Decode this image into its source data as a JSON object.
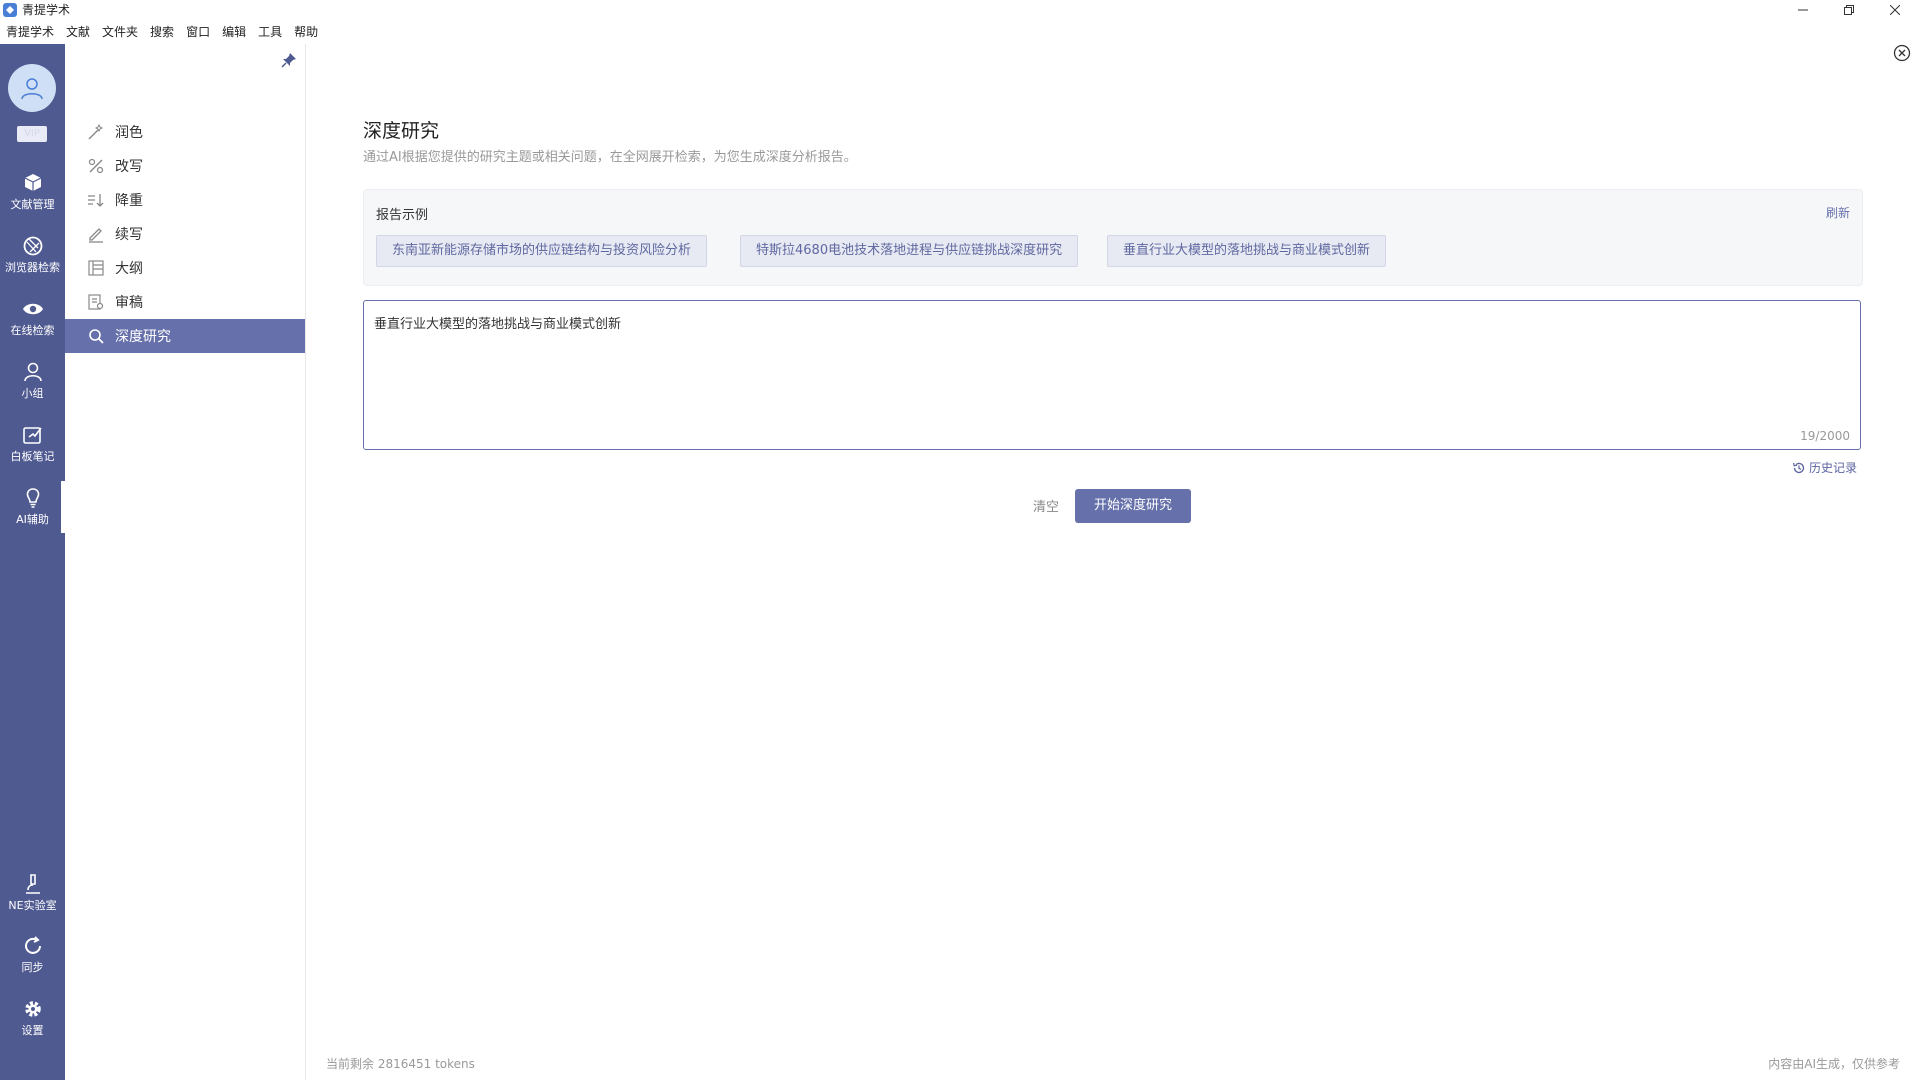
{
  "window": {
    "title": "青提学术"
  },
  "menu": [
    "青提学术",
    "文献",
    "文件夹",
    "搜索",
    "窗口",
    "编辑",
    "工具",
    "帮助"
  ],
  "rail": {
    "vip": "VIP",
    "items": [
      {
        "label": "文献管理",
        "icon": "box-icon"
      },
      {
        "label": "浏览器检索",
        "icon": "browser-icon"
      },
      {
        "label": "在线检索",
        "icon": "eye-icon"
      },
      {
        "label": "小组",
        "icon": "group-icon"
      },
      {
        "label": "白板笔记",
        "icon": "whiteboard-icon"
      },
      {
        "label": "AI辅助",
        "icon": "bulb-icon"
      },
      {
        "label": "NE实验室",
        "icon": "microscope-icon"
      },
      {
        "label": "同步",
        "icon": "sync-icon"
      },
      {
        "label": "设置",
        "icon": "gear-icon"
      }
    ]
  },
  "sidebar": {
    "items": [
      {
        "label": "润色",
        "icon": "magic-wand-icon"
      },
      {
        "label": "改写",
        "icon": "rewrite-icon"
      },
      {
        "label": "降重",
        "icon": "reduce-icon"
      },
      {
        "label": "续写",
        "icon": "pen-icon"
      },
      {
        "label": "大纲",
        "icon": "outline-icon"
      },
      {
        "label": "审稿",
        "icon": "review-icon"
      },
      {
        "label": "深度研究",
        "icon": "search-icon"
      }
    ],
    "active_index": 6
  },
  "main": {
    "title": "深度研究",
    "description": "通过AI根据您提供的研究主题或相关问题，在全网展开检索，为您生成深度分析报告。",
    "examples": {
      "title": "报告示例",
      "refresh": "刷新",
      "chips": [
        "东南亚新能源存储市场的供应链结构与投资风险分析",
        "特斯拉4680电池技术落地进程与供应链挑战深度研究",
        "垂直行业大模型的落地挑战与商业模式创新"
      ]
    },
    "input": {
      "value": "垂直行业大模型的落地挑战与商业模式创新",
      "counter": "19/2000"
    },
    "history": "历史记录",
    "clear": "清空",
    "start": "开始深度研究"
  },
  "footer": {
    "tokens": "当前剩余 2816451 tokens",
    "disclaimer": "内容由AI生成，仅供参考"
  },
  "colors": {
    "rail": "#4f5a91",
    "accent": "#6671ab"
  }
}
